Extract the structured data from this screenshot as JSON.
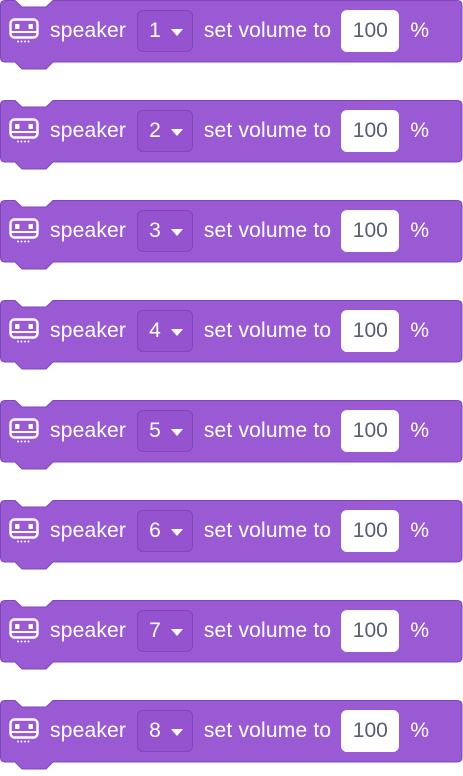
{
  "colors": {
    "block_fill": "#9a5ad3",
    "block_stroke": "#7f47b8",
    "field_bg": "#ffffff",
    "field_text": "#575e75",
    "label_text": "#ffffff"
  },
  "blocks": [
    {
      "icon": "robot-icon",
      "label": "speaker",
      "speaker": "1",
      "action": "set volume to",
      "value": "100",
      "unit": "%"
    },
    {
      "icon": "robot-icon",
      "label": "speaker",
      "speaker": "2",
      "action": "set volume to",
      "value": "100",
      "unit": "%"
    },
    {
      "icon": "robot-icon",
      "label": "speaker",
      "speaker": "3",
      "action": "set volume to",
      "value": "100",
      "unit": "%"
    },
    {
      "icon": "robot-icon",
      "label": "speaker",
      "speaker": "4",
      "action": "set volume to",
      "value": "100",
      "unit": "%"
    },
    {
      "icon": "robot-icon",
      "label": "speaker",
      "speaker": "5",
      "action": "set volume to",
      "value": "100",
      "unit": "%"
    },
    {
      "icon": "robot-icon",
      "label": "speaker",
      "speaker": "6",
      "action": "set volume to",
      "value": "100",
      "unit": "%"
    },
    {
      "icon": "robot-icon",
      "label": "speaker",
      "speaker": "7",
      "action": "set volume to",
      "value": "100",
      "unit": "%"
    },
    {
      "icon": "robot-icon",
      "label": "speaker",
      "speaker": "8",
      "action": "set volume to",
      "value": "100",
      "unit": "%"
    }
  ]
}
